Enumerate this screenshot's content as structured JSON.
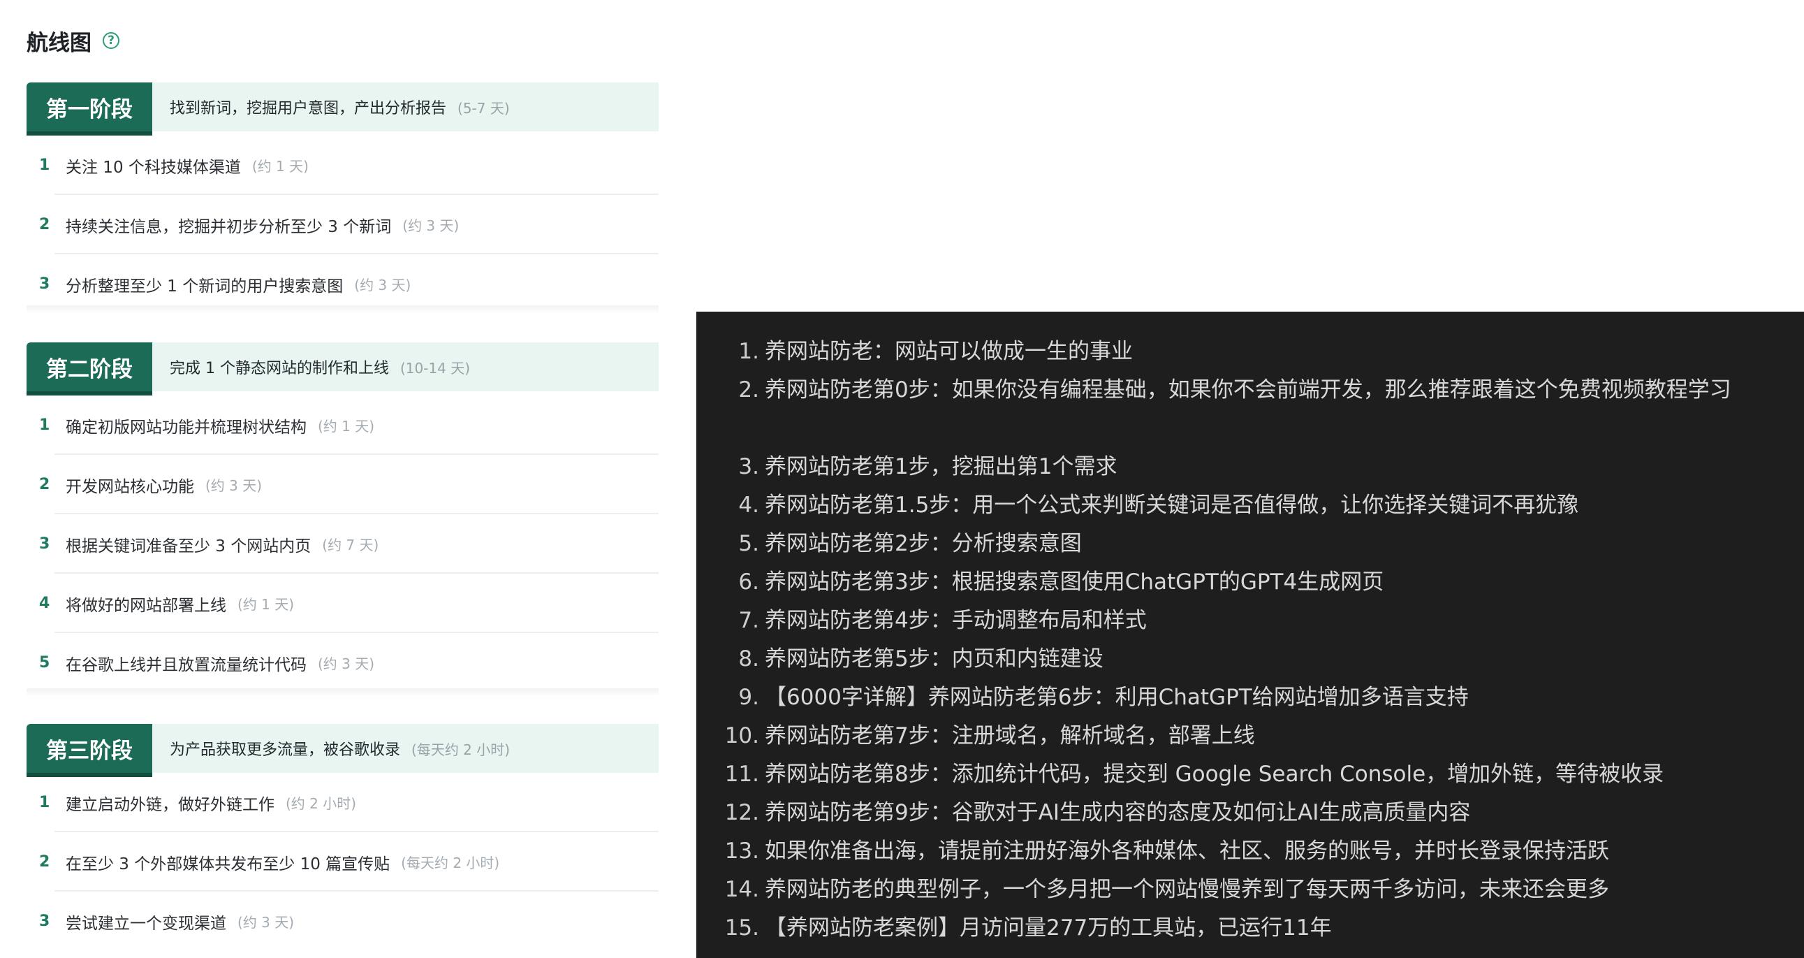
{
  "roadmap": {
    "title": "航线图",
    "help_icon": "?",
    "stages": [
      {
        "badge": "第一阶段",
        "desc": "找到新词，挖掘用户意图，产出分析报告",
        "duration": "(5-7 天)",
        "steps": [
          {
            "num": "1",
            "text": "关注 10 个科技媒体渠道",
            "dur": "(约 1 天)"
          },
          {
            "num": "2",
            "text": "持续关注信息，挖掘并初步分析至少 3 个新词",
            "dur": "(约 3 天)"
          },
          {
            "num": "3",
            "text": "分析整理至少 1 个新词的用户搜索意图",
            "dur": "(约 3 天)"
          }
        ]
      },
      {
        "badge": "第二阶段",
        "desc": "完成 1 个静态网站的制作和上线",
        "duration": "(10-14 天)",
        "steps": [
          {
            "num": "1",
            "text": "确定初版网站功能并梳理树状结构",
            "dur": "(约 1 天)"
          },
          {
            "num": "2",
            "text": "开发网站核心功能",
            "dur": "(约 3 天)"
          },
          {
            "num": "3",
            "text": "根据关键词准备至少 3 个网站内页",
            "dur": "(约 7 天)"
          },
          {
            "num": "4",
            "text": "将做好的网站部署上线",
            "dur": "(约 1 天)"
          },
          {
            "num": "5",
            "text": "在谷歌上线并且放置流量统计代码",
            "dur": "(约 3 天)"
          }
        ]
      },
      {
        "badge": "第三阶段",
        "desc": "为产品获取更多流量，被谷歌收录",
        "duration": "(每天约 2 小时)",
        "steps": [
          {
            "num": "1",
            "text": "建立启动外链，做好外链工作",
            "dur": "(约 2 小时)"
          },
          {
            "num": "2",
            "text": "在至少 3 个外部媒体共发布至少 10 篇宣传贴",
            "dur": "(每天约 2 小时)"
          },
          {
            "num": "3",
            "text": "尝试建立一个变现渠道",
            "dur": "(约 3 天)"
          }
        ]
      }
    ]
  },
  "articles": [
    {
      "num": "1.",
      "text": "养网站防老：网站可以做成一生的事业"
    },
    {
      "num": "2.",
      "text": "养网站防老第0步：如果你没有编程基础，如果你不会前端开发，那么推荐跟着这个免费视频教程学习"
    },
    {
      "num": "3.",
      "text": "养网站防老第1步，挖掘出第1个需求"
    },
    {
      "num": "4.",
      "text": "养网站防老第1.5步：用一个公式来判断关键词是否值得做，让你选择关键词不再犹豫"
    },
    {
      "num": "5.",
      "text": "养网站防老第2步：分析搜索意图"
    },
    {
      "num": "6.",
      "text": "养网站防老第3步：根据搜索意图使用ChatGPT的GPT4生成网页"
    },
    {
      "num": "7.",
      "text": "养网站防老第4步：手动调整布局和样式"
    },
    {
      "num": "8.",
      "text": "养网站防老第5步：内页和内链建设"
    },
    {
      "num": "9.",
      "text": "【6000字详解】养网站防老第6步：利用ChatGPT给网站增加多语言支持"
    },
    {
      "num": "10.",
      "text": "养网站防老第7步：注册域名，解析域名，部署上线"
    },
    {
      "num": "11.",
      "text": "养网站防老第8步：添加统计代码，提交到 Google Search Console，增加外链，等待被收录"
    },
    {
      "num": "12.",
      "text": "养网站防老第9步：谷歌对于AI生成内容的态度及如何让AI生成高质量内容"
    },
    {
      "num": "13.",
      "text": "如果你准备出海，请提前注册好海外各种媒体、社区、服务的账号，并时长登录保持活跃"
    },
    {
      "num": "14.",
      "text": "养网站防老的典型例子，一个多月把一个网站慢慢养到了每天两千多访问，未来还会更多"
    },
    {
      "num": "15.",
      "text": "【养网站防老案例】月访问量277万的工具站，已运行11年"
    }
  ]
}
